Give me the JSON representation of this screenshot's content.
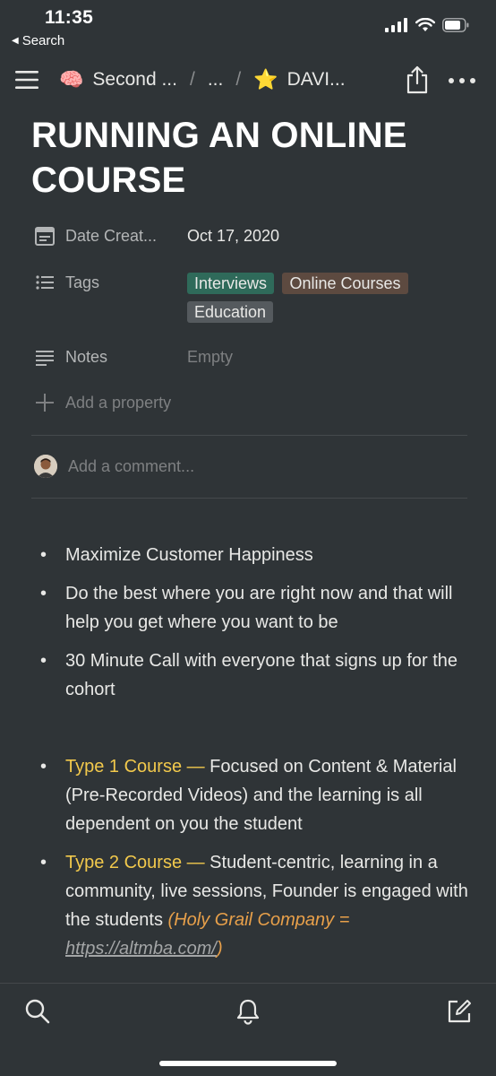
{
  "status": {
    "time": "11:35",
    "back_label": "Search"
  },
  "breadcrumb": {
    "items": [
      {
        "emoji": "🧠",
        "label": "Second ..."
      },
      {
        "emoji": "",
        "label": "..."
      },
      {
        "emoji": "⭐",
        "label": "DAVI..."
      }
    ],
    "separator": "/"
  },
  "page": {
    "title": "RUNNING AN ONLINE COURSE"
  },
  "properties": [
    {
      "name": "Date Creat...",
      "value": "Oct 17, 2020"
    },
    {
      "name": "Tags",
      "tags": [
        {
          "label": "Interviews",
          "color": "#2f6a5a"
        },
        {
          "label": "Online Courses",
          "color": "#5d4a40"
        },
        {
          "label": "Education",
          "color": "#555a5e"
        }
      ]
    },
    {
      "name": "Notes",
      "value": "Empty"
    }
  ],
  "add_property_label": "Add a property",
  "comment_placeholder": "Add a comment...",
  "bullets": [
    {
      "text": "Maximize Customer Happiness"
    },
    {
      "text": "Do the best where you are right now and that will help you get where you want to be"
    },
    {
      "text": "30 Minute Call with everyone that signs up for the cohort"
    },
    {
      "highlight": "Type 1 Course —",
      "text": " Focused on Content & Material (Pre-Recorded Videos) and the learning is all dependent on you the student"
    },
    {
      "highlight": "Type 2 Course —",
      "text": " Student-centric, learning in a community, live sessions, Founder is engaged with the students ",
      "note_prefix": "(Holy Grail Company = ",
      "link": "https://altmba.com/",
      "note_suffix": ")"
    }
  ],
  "colors": {
    "background": "#2f3437",
    "highlight_yellow": "#f2c94c",
    "highlight_orange": "#e8a04a"
  },
  "icons": {
    "menu": "hamburger-icon",
    "share": "share-icon",
    "more": "more-icon",
    "search": "search-icon",
    "notifications": "bell-icon",
    "compose": "compose-icon"
  }
}
